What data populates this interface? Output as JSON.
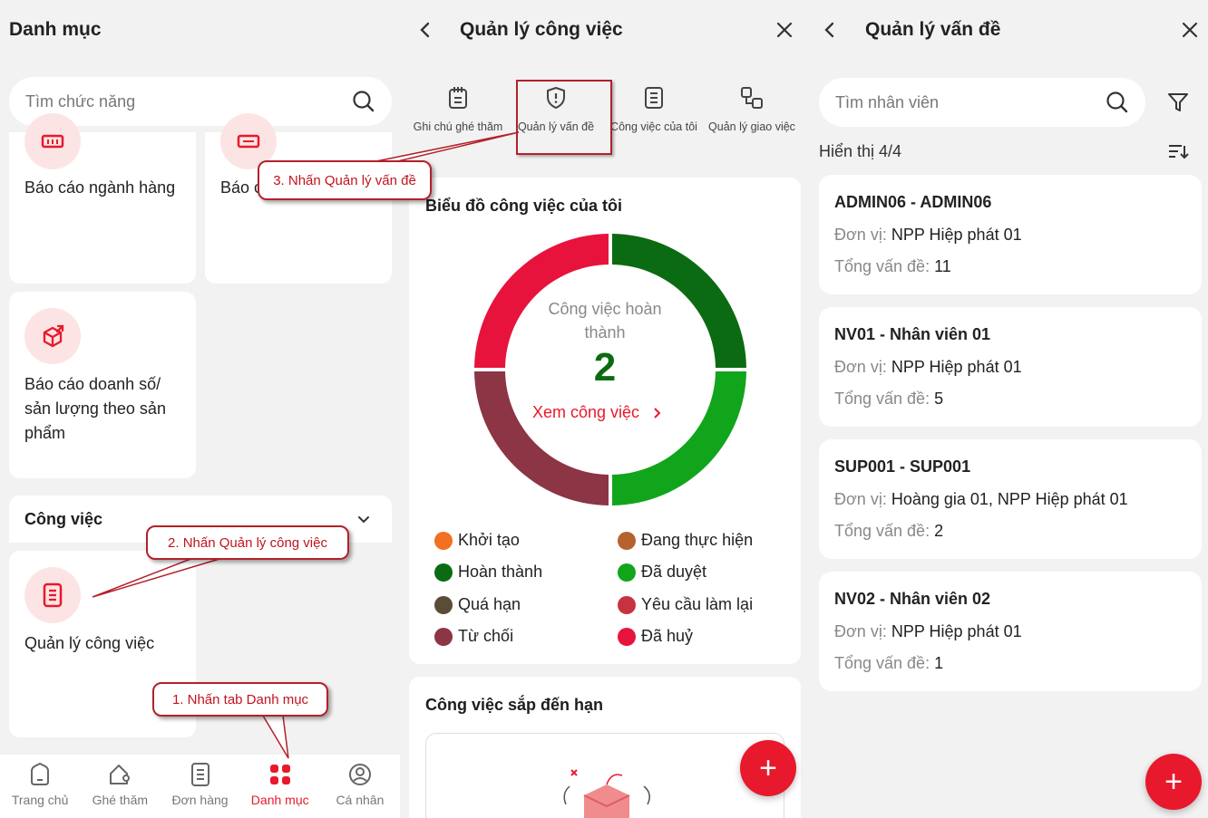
{
  "panel1": {
    "title": "Danh mục",
    "search_placeholder": "Tìm chức năng",
    "cards": [
      {
        "label": "Báo cáo ngành hàng",
        "icon": "report-icon"
      },
      {
        "label": "Báo c",
        "icon": "report-icon"
      },
      {
        "label": "Báo cáo doanh số/ sản lượng theo sản phẩm",
        "icon": "box-icon"
      }
    ],
    "section_title": "Công việc",
    "work_card_label": "Quản lý công việc",
    "nav": [
      {
        "label": "Trang chủ",
        "icon": "home-icon"
      },
      {
        "label": "Ghé thăm",
        "icon": "visit-icon"
      },
      {
        "label": "Đơn hàng",
        "icon": "order-icon"
      },
      {
        "label": "Danh mục",
        "icon": "grid-icon",
        "active": true
      },
      {
        "label": "Cá nhân",
        "icon": "user-icon"
      }
    ]
  },
  "callouts": {
    "c1": "1. Nhấn tab Danh mục",
    "c2": "2. Nhấn Quản lý công việc",
    "c3": "3. Nhấn Quản lý vấn đề"
  },
  "panel2": {
    "title": "Quản lý công việc",
    "tools": [
      {
        "label": "Ghi chú ghé thăm",
        "icon": "notepad-icon"
      },
      {
        "label": "Quản lý vấn đề",
        "icon": "shield-alert-icon"
      },
      {
        "label": "Công việc của tôi",
        "icon": "document-icon"
      },
      {
        "label": "Quản lý giao việc",
        "icon": "assign-icon"
      }
    ],
    "chart_title": "Biểu đồ công việc của tôi",
    "center_label": "Công việc hoàn thành",
    "center_value": "2",
    "view_link": "Xem công việc",
    "legend": [
      {
        "label": "Khởi tạo",
        "color": "#f36f21"
      },
      {
        "label": "Đang thực hiện",
        "color": "#b5622f"
      },
      {
        "label": "Hoàn thành",
        "color": "#0b6b12"
      },
      {
        "label": "Đã duyệt",
        "color": "#11a51b"
      },
      {
        "label": "Quá hạn",
        "color": "#5b4c36"
      },
      {
        "label": "Yêu cầu làm lại",
        "color": "#c83240"
      },
      {
        "label": "Từ chối",
        "color": "#8c3544"
      },
      {
        "label": "Đã huỷ",
        "color": "#e8133c"
      }
    ],
    "upcoming_title": "Công việc sắp đến hạn"
  },
  "panel3": {
    "title": "Quản lý vấn đề",
    "search_placeholder": "Tìm nhân viên",
    "count_text": "Hiển thị 4/4",
    "unit_label": "Đơn vị:",
    "total_label": "Tổng vấn đề:",
    "employees": [
      {
        "name": "ADMIN06 - ADMIN06",
        "unit": "NPP Hiệp phát 01",
        "total": "11"
      },
      {
        "name": "NV01 - Nhân viên 01",
        "unit": "NPP Hiệp phát 01",
        "total": "5"
      },
      {
        "name": "SUP001 - SUP001",
        "unit": "Hoàng gia 01, NPP Hiệp phát 01",
        "total": "2"
      },
      {
        "name": "NV02 - Nhân viên 02",
        "unit": "NPP Hiệp phát 01",
        "total": "1"
      }
    ]
  },
  "colors": {
    "accent": "#e8192c",
    "callout_border": "#b3212b"
  }
}
